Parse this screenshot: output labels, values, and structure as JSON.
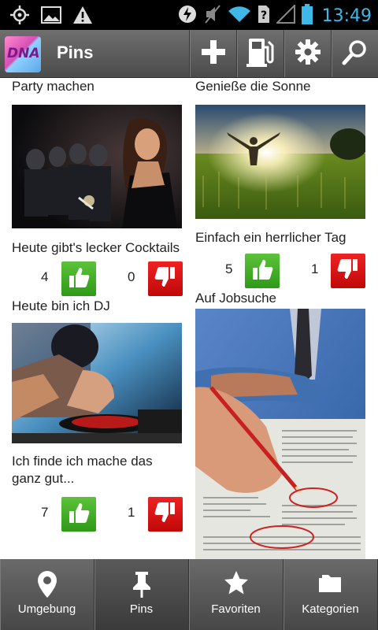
{
  "status_bar": {
    "time": "13:49",
    "icons": [
      "gps-icon",
      "gallery-icon",
      "warning-icon",
      "battery-saver-icon",
      "mute-icon",
      "wifi-icon",
      "sim-icon",
      "signal-icon",
      "battery-icon"
    ]
  },
  "app_bar": {
    "logo_text": "DNA",
    "title": "Pins",
    "actions": [
      "add-icon",
      "fuel-icon",
      "settings-icon",
      "search-icon"
    ]
  },
  "left_column": [
    {
      "title": "Party machen",
      "caption": "Heute gibt's lecker Cocktails",
      "likes": "4",
      "dislikes": "0"
    },
    {
      "title": "Heute bin ich DJ",
      "caption": "Ich finde ich mache das ganz gut...",
      "likes": "7",
      "dislikes": "1"
    }
  ],
  "right_column": [
    {
      "title": "Genieße die Sonne",
      "caption": "Einfach ein herrlicher Tag",
      "likes": "5",
      "dislikes": "1"
    },
    {
      "title": "Auf Jobsuche"
    }
  ],
  "bottom_nav": [
    {
      "label": "Umgebung",
      "icon": "location-pin-icon",
      "active": false
    },
    {
      "label": "Pins",
      "icon": "pushpin-icon",
      "active": true
    },
    {
      "label": "Favoriten",
      "icon": "star-icon",
      "active": false
    },
    {
      "label": "Kategorien",
      "icon": "folder-icon",
      "active": false
    }
  ],
  "colors": {
    "status_bar": "#000000",
    "clock": "#3fb8e8",
    "app_bar": "#5a5a5a",
    "like": "#3aa820",
    "dislike": "#dd1111"
  }
}
